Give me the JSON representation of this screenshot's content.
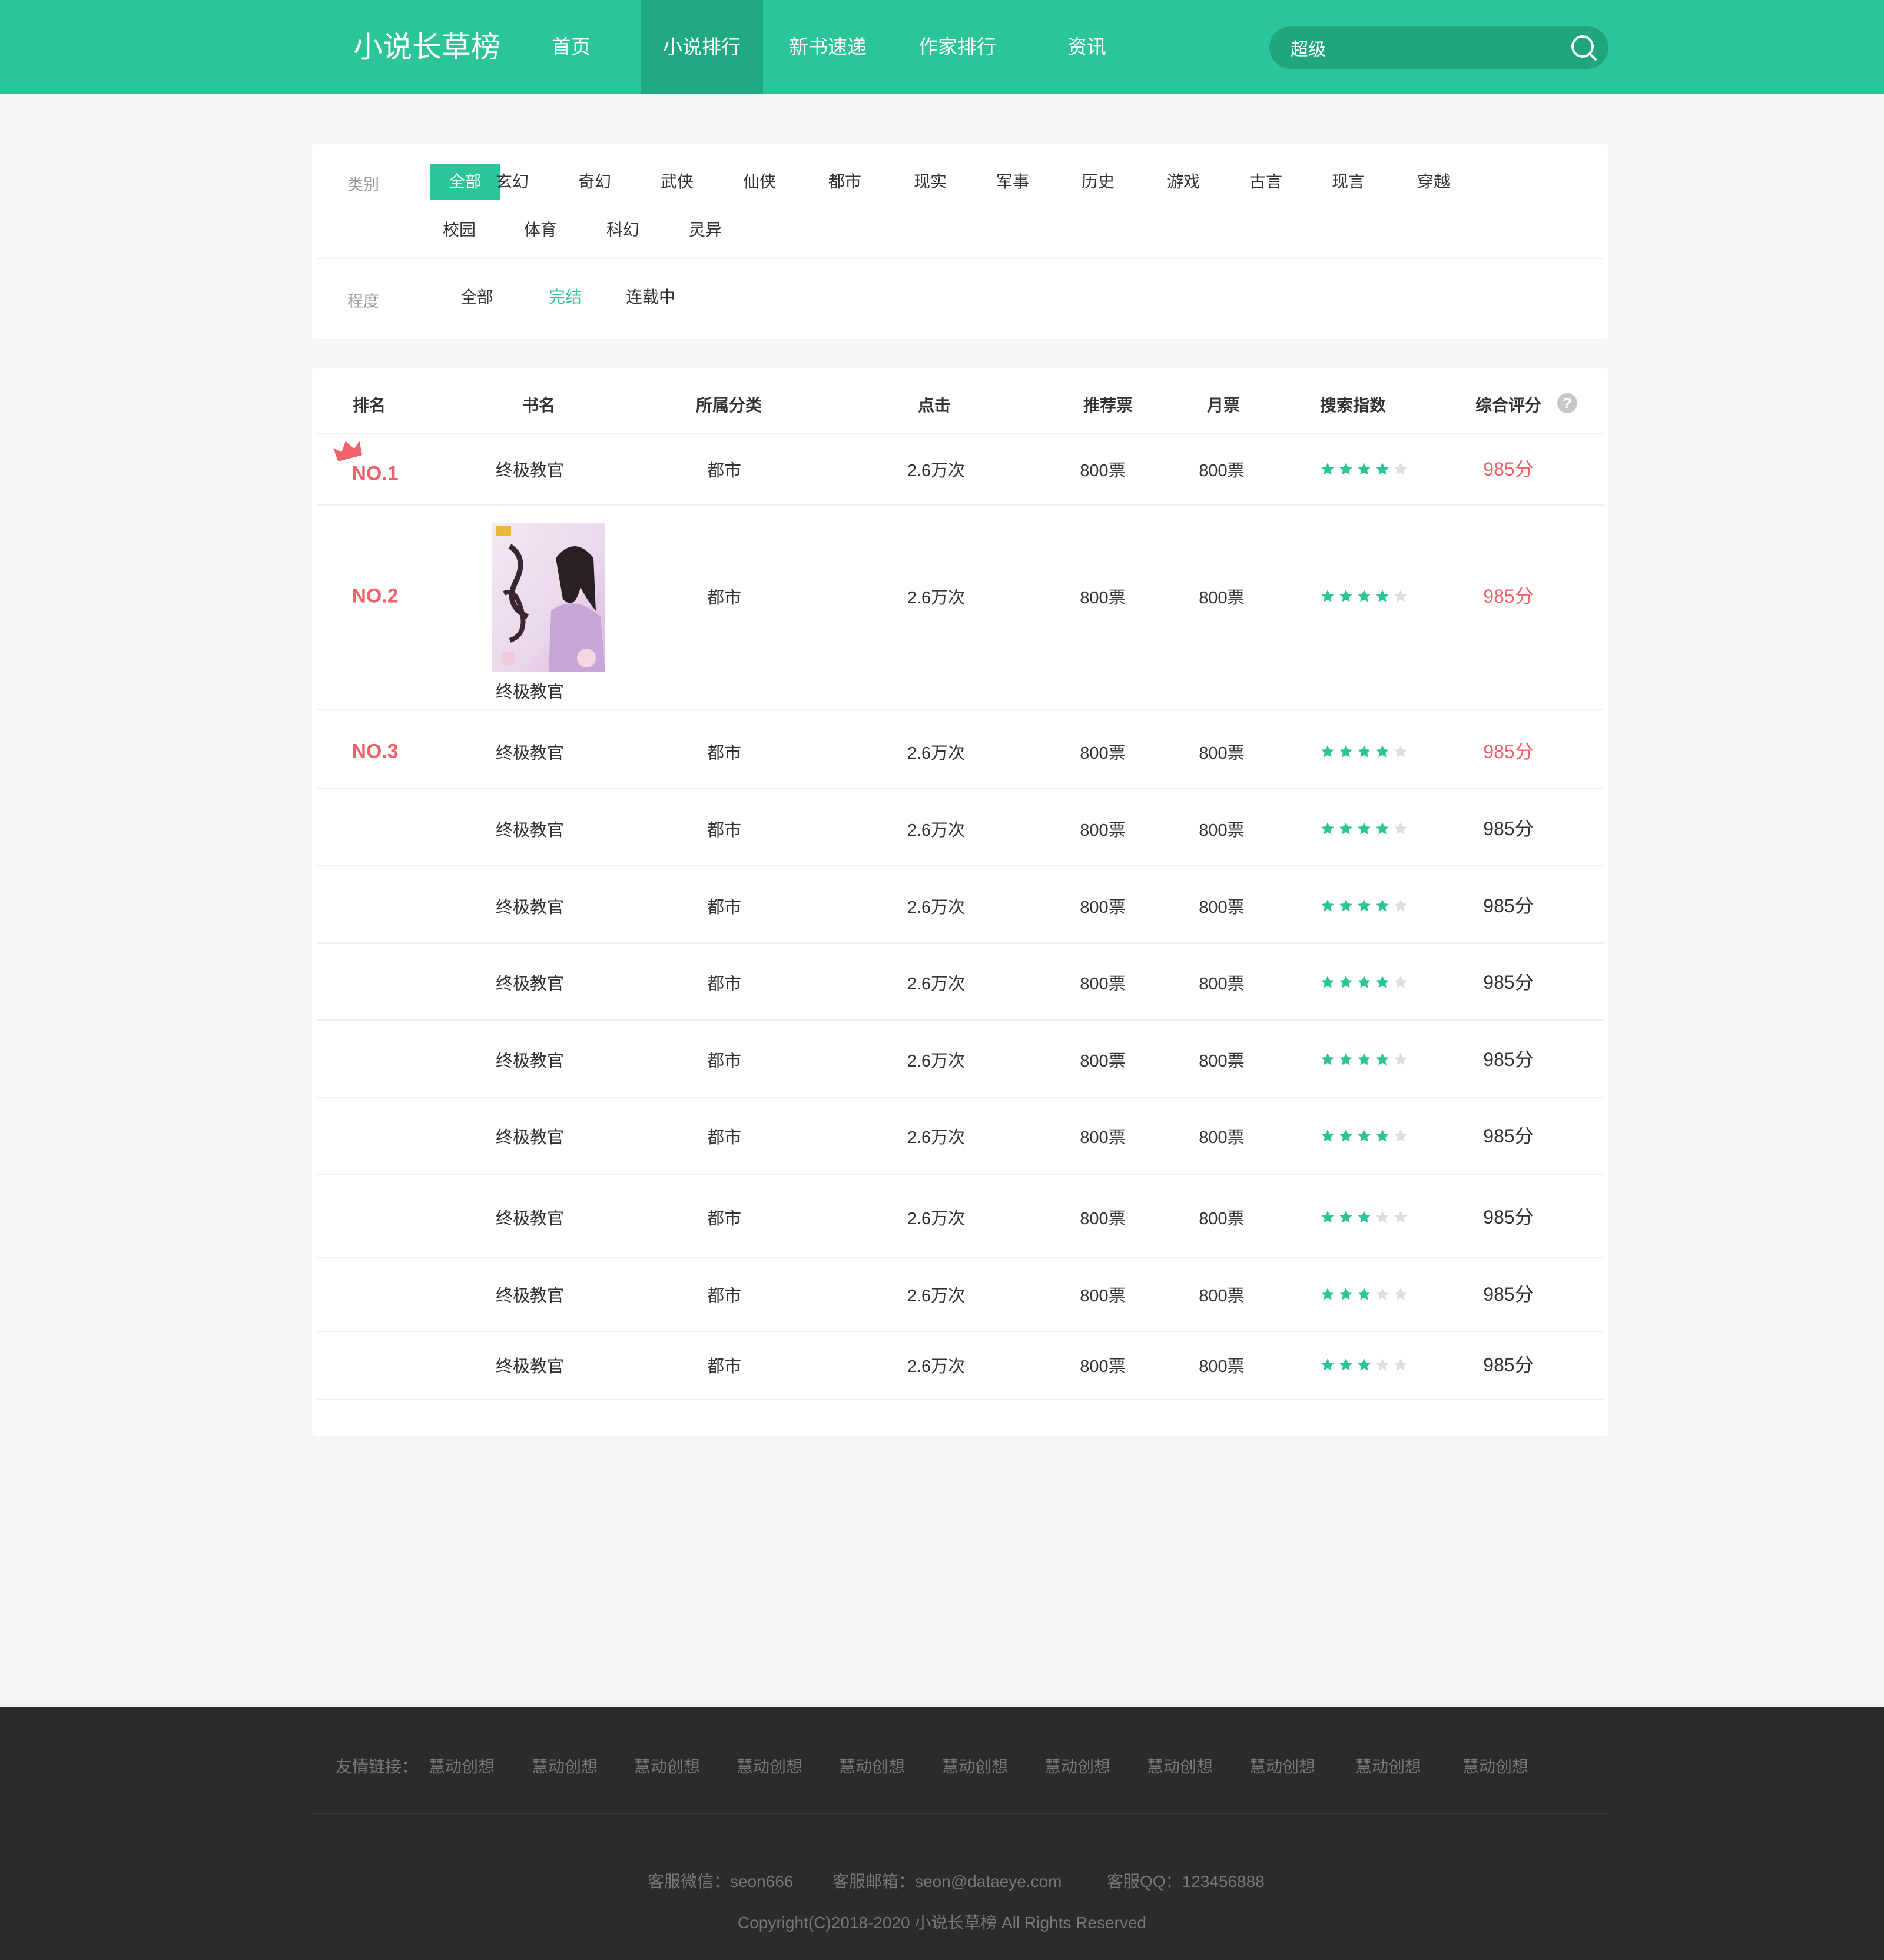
{
  "header": {
    "logo": "小说长草榜",
    "nav": [
      {
        "label": "首页"
      },
      {
        "label": "小说排行"
      },
      {
        "label": "新书速递"
      },
      {
        "label": "作家排行"
      },
      {
        "label": "资讯"
      }
    ],
    "search_value": "超级"
  },
  "filter": {
    "category_label": "类别",
    "categories": [
      "全部",
      "玄幻",
      "奇幻",
      "武侠",
      "仙侠",
      "都市",
      "现实",
      "军事",
      "历史",
      "游戏",
      "古言",
      "现言",
      "穿越",
      "校园",
      "体育",
      "科幻",
      "灵异"
    ],
    "progress_label": "程度",
    "progress": [
      "全部",
      "完结",
      "连载中"
    ]
  },
  "table": {
    "headers": [
      "排名",
      "书名",
      "所属分类",
      "点击",
      "推荐票",
      "月票",
      "搜索指数",
      "综合评分"
    ],
    "rows": [
      {
        "rank": "NO.1",
        "name": "终极教官",
        "category": "都市",
        "clicks": "2.6万次",
        "rec": "800票",
        "month": "800票",
        "stars": 4,
        "score": "985分"
      },
      {
        "rank": "NO.2",
        "name": "终极教官",
        "category": "都市",
        "clicks": "2.6万次",
        "rec": "800票",
        "month": "800票",
        "stars": 4,
        "score": "985分"
      },
      {
        "rank": "NO.3",
        "name": "终极教官",
        "category": "都市",
        "clicks": "2.6万次",
        "rec": "800票",
        "month": "800票",
        "stars": 4,
        "score": "985分"
      },
      {
        "rank": "",
        "name": "终极教官",
        "category": "都市",
        "clicks": "2.6万次",
        "rec": "800票",
        "month": "800票",
        "stars": 4,
        "score": "985分"
      },
      {
        "rank": "",
        "name": "终极教官",
        "category": "都市",
        "clicks": "2.6万次",
        "rec": "800票",
        "month": "800票",
        "stars": 4,
        "score": "985分"
      },
      {
        "rank": "",
        "name": "终极教官",
        "category": "都市",
        "clicks": "2.6万次",
        "rec": "800票",
        "month": "800票",
        "stars": 4,
        "score": "985分"
      },
      {
        "rank": "",
        "name": "终极教官",
        "category": "都市",
        "clicks": "2.6万次",
        "rec": "800票",
        "month": "800票",
        "stars": 4,
        "score": "985分"
      },
      {
        "rank": "",
        "name": "终极教官",
        "category": "都市",
        "clicks": "2.6万次",
        "rec": "800票",
        "month": "800票",
        "stars": 4,
        "score": "985分"
      },
      {
        "rank": "",
        "name": "终极教官",
        "category": "都市",
        "clicks": "2.6万次",
        "rec": "800票",
        "month": "800票",
        "stars": 3,
        "score": "985分"
      },
      {
        "rank": "",
        "name": "终极教官",
        "category": "都市",
        "clicks": "2.6万次",
        "rec": "800票",
        "month": "800票",
        "stars": 3,
        "score": "985分"
      },
      {
        "rank": "",
        "name": "终极教官",
        "category": "都市",
        "clicks": "2.6万次",
        "rec": "800票",
        "month": "800票",
        "stars": 3,
        "score": "985分"
      }
    ]
  },
  "footer": {
    "links_label": "友情链接：",
    "links": [
      "慧动创想",
      "慧动创想",
      "慧动创想",
      "慧动创想",
      "慧动创想",
      "慧动创想",
      "慧动创想",
      "慧动创想",
      "慧动创想",
      "慧动创想",
      "慧动创想"
    ],
    "wechat": "客服微信：seon666",
    "email": "客服邮箱：seon@dataeye.com",
    "qq": "客服QQ：123456888",
    "copyright": "Copyright(C)2018-2020 小说长草榜 All Rights Reserved"
  },
  "colors": {
    "accent": "#2cc599",
    "rank_red": "#f0616a",
    "star_on": "#2cc599",
    "star_off": "#dddddd"
  }
}
